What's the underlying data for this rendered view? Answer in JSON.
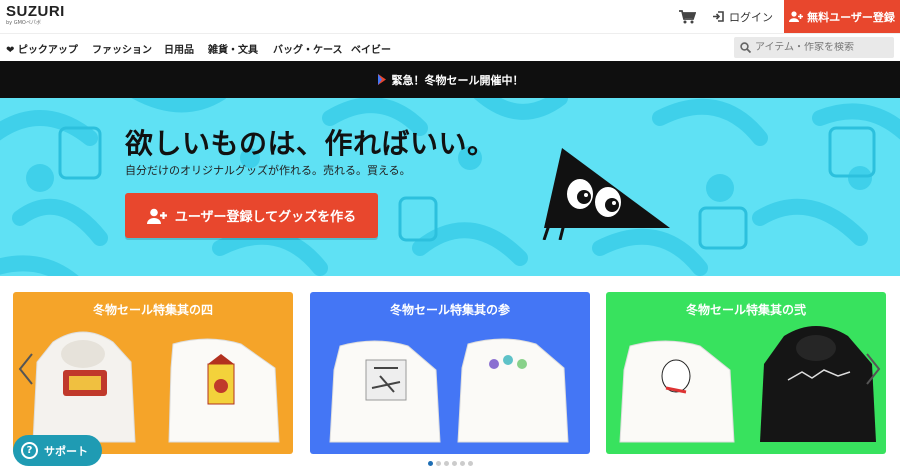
{
  "header": {
    "logo": "SUZURI",
    "logo_sub": "by GMOペパボ",
    "login_label": "ログイン",
    "signup_label": "無料ユーザー登録"
  },
  "nav": {
    "items": [
      "ピックアップ",
      "ファッション",
      "日用品",
      "雑貨・文具",
      "バッグ・ケース",
      "ベイビー"
    ],
    "search_placeholder": "アイテム・作家を検索"
  },
  "sale_banner": "緊急！冬物セール開催中！",
  "hero": {
    "title": "欲しいものは、作ればいい。",
    "subtitle": "自分だけのオリジナルグッズが作れる。売れる。買える。",
    "cta_label": "ユーザー登録してグッズを作る"
  },
  "carousel": {
    "cards": [
      {
        "title": "冬物セール特集其の四",
        "color": "#f5a429"
      },
      {
        "title": "冬物セール特集其の参",
        "color": "#4476f5"
      },
      {
        "title": "冬物セール特集其の弐",
        "color": "#38e25e"
      }
    ],
    "dot_count": 6,
    "active_dot": 1
  },
  "support_label": "サポート",
  "colors": {
    "accent": "#e8472d",
    "hero_bg": "#5fe1f4",
    "support": "#1f9bb3"
  }
}
